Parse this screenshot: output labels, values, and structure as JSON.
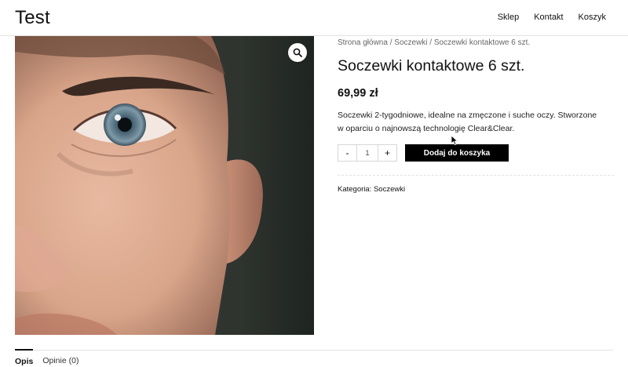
{
  "header": {
    "site_title": "Test",
    "nav": [
      "Sklep",
      "Kontakt",
      "Koszyk"
    ]
  },
  "product": {
    "image_zoom_icon": "search-icon",
    "breadcrumb": {
      "home": "Strona główna",
      "sep": " / ",
      "category": "Soczewki",
      "current": "Soczewki kontaktowe 6 szt."
    },
    "title": "Soczewki kontaktowe 6 szt.",
    "price": "69,99 zł",
    "description": "Soczewki 2-tygodniowe, idealne na zmęczone i suche oczy. Stworzone w oparciu o najnowszą technologię Clear&Clear.",
    "quantity": {
      "minus": "-",
      "value": "1",
      "plus": "+"
    },
    "add_to_cart": "Dodaj do koszyka",
    "meta": {
      "label": "Kategoria: ",
      "category": "Soczewki"
    }
  },
  "tabs": [
    {
      "label": "Opis",
      "active": true
    },
    {
      "label": "Opinie (0)",
      "active": false
    }
  ]
}
